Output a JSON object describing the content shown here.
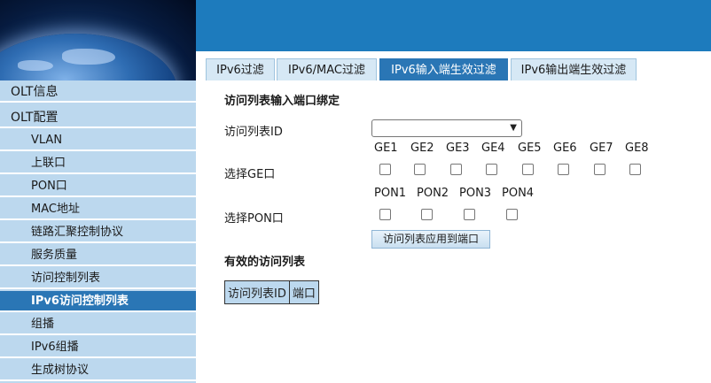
{
  "tabs": [
    {
      "label": "IPv6过滤",
      "active": false
    },
    {
      "label": "IPv6/MAC过滤",
      "active": false
    },
    {
      "label": "IPv6输入端生效过滤",
      "active": true
    },
    {
      "label": "IPv6输出端生效过滤",
      "active": false
    }
  ],
  "sidebar": {
    "items": [
      {
        "label": "OLT信息",
        "level": "top"
      },
      {
        "label": "OLT配置",
        "level": "top"
      },
      {
        "label": "VLAN",
        "level": "sub"
      },
      {
        "label": "上联口",
        "level": "sub"
      },
      {
        "label": "PON口",
        "level": "sub"
      },
      {
        "label": "MAC地址",
        "level": "sub"
      },
      {
        "label": "链路汇聚控制协议",
        "level": "sub"
      },
      {
        "label": "服务质量",
        "level": "sub"
      },
      {
        "label": "访问控制列表",
        "level": "sub"
      },
      {
        "label": "IPv6访问控制列表",
        "level": "sub",
        "active": true
      },
      {
        "label": "组播",
        "level": "sub"
      },
      {
        "label": "IPv6组播",
        "level": "sub"
      },
      {
        "label": "生成树协议",
        "level": "sub"
      }
    ]
  },
  "main": {
    "bind_heading": "访问列表输入端口绑定",
    "acl_id_label": "访问列表ID",
    "acl_id_value": "",
    "ge_label": "选择GE口",
    "ge_ports": [
      "GE1",
      "GE2",
      "GE3",
      "GE4",
      "GE5",
      "GE6",
      "GE7",
      "GE8"
    ],
    "pon_label": "选择PON口",
    "pon_ports": [
      "PON1",
      "PON2",
      "PON3",
      "PON4"
    ],
    "apply_button": "访问列表应用到端口",
    "valid_heading": "有效的访问列表",
    "table_headers": [
      "访问列表ID",
      "端口"
    ]
  }
}
